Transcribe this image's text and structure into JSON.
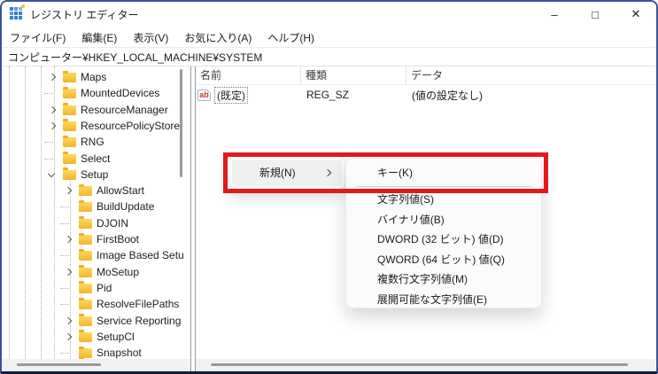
{
  "window": {
    "title": "レジストリ エディター",
    "app_icon": "registry-grid-icon",
    "controls": {
      "minimize": "–",
      "maximize": "□",
      "close": "✕"
    }
  },
  "menu_bar": {
    "items": [
      "ファイル(F)",
      "編集(E)",
      "表示(V)",
      "お気に入り(A)",
      "ヘルプ(H)"
    ]
  },
  "address_bar": {
    "path": "コンピューター¥HKEY_LOCAL_MACHINE¥SYSTEM"
  },
  "tree": {
    "items": [
      {
        "label": "Maps",
        "depth": 0,
        "state": "collapsed"
      },
      {
        "label": "MountedDevices",
        "depth": 0,
        "state": "leaf"
      },
      {
        "label": "ResourceManager",
        "depth": 0,
        "state": "collapsed"
      },
      {
        "label": "ResourcePolicyStore",
        "depth": 0,
        "state": "collapsed"
      },
      {
        "label": "RNG",
        "depth": 0,
        "state": "leaf"
      },
      {
        "label": "Select",
        "depth": 0,
        "state": "leaf"
      },
      {
        "label": "Setup",
        "depth": 0,
        "state": "expanded"
      },
      {
        "label": "AllowStart",
        "depth": 1,
        "state": "collapsed"
      },
      {
        "label": "BuildUpdate",
        "depth": 1,
        "state": "leaf"
      },
      {
        "label": "DJOIN",
        "depth": 1,
        "state": "leaf"
      },
      {
        "label": "FirstBoot",
        "depth": 1,
        "state": "collapsed"
      },
      {
        "label": "Image Based Setu",
        "depth": 1,
        "state": "leaf"
      },
      {
        "label": "MoSetup",
        "depth": 1,
        "state": "collapsed"
      },
      {
        "label": "Pid",
        "depth": 1,
        "state": "leaf"
      },
      {
        "label": "ResolveFilePaths",
        "depth": 1,
        "state": "leaf"
      },
      {
        "label": "Service Reporting",
        "depth": 1,
        "state": "collapsed"
      },
      {
        "label": "SetupCl",
        "depth": 1,
        "state": "collapsed"
      },
      {
        "label": "Snapshot",
        "depth": 1,
        "state": "leaf"
      },
      {
        "label": "",
        "depth": 1,
        "state": "partial"
      }
    ]
  },
  "list": {
    "columns": [
      "名前",
      "種類",
      "データ"
    ],
    "rows": [
      {
        "icon": "string-value-icon",
        "icon_text": "ab",
        "name": "(既定)",
        "type": "REG_SZ",
        "data": "(値の設定なし)"
      }
    ]
  },
  "context_menu": {
    "items": [
      {
        "label": "新規(N)",
        "has_submenu": true,
        "hovered": true
      }
    ]
  },
  "submenu": {
    "items": [
      {
        "label": "キー(K)"
      },
      {
        "separator": true
      },
      {
        "label": "文字列値(S)"
      },
      {
        "label": "バイナリ値(B)"
      },
      {
        "label": "DWORD (32 ビット) 値(D)"
      },
      {
        "label": "QWORD (64 ビット) 値(Q)"
      },
      {
        "label": "複数行文字列値(M)"
      },
      {
        "label": "展開可能な文字列値(E)"
      }
    ]
  },
  "annotation": {
    "type": "highlight-rectangle",
    "color": "#df1b1b"
  },
  "colors": {
    "window_border": "#3b5494",
    "window_border_bottom": "#141b45",
    "folder_yellow": "#f5b42c",
    "accent_blue": "#2f7fd6",
    "menu_hover": "#f0f0f0",
    "scrollbar_thumb": "#9a9a9a"
  }
}
